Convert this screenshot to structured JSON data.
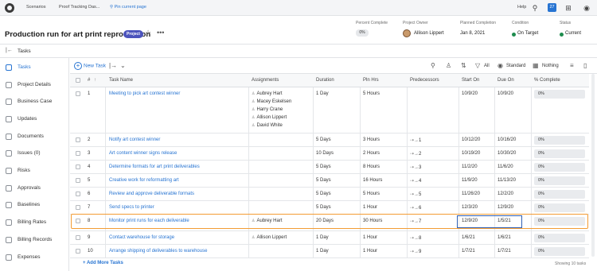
{
  "topbar": {
    "tabs": [
      "Scenarios",
      "Proof Tracking Das..."
    ],
    "pin_label": "Pin current page",
    "help": "Help",
    "badge_count": "27"
  },
  "header": {
    "title": "Production run for art print reproduction",
    "badge": "Project",
    "percent_label": "Percent Complete",
    "percent_value": "0%",
    "owner_label": "Project Owner",
    "owner_value": "Allison Lippert",
    "planned_label": "Planned Completion",
    "planned_value": "Jan 8, 2021",
    "condition_label": "Condition",
    "condition_value": "On Target",
    "status_label": "Status",
    "status_value": "Current",
    "accent_color": "#1e8c4e"
  },
  "subbar": {
    "label": "Tasks"
  },
  "sidebar": {
    "items": [
      {
        "label": "Tasks",
        "icon": "tasks-icon"
      },
      {
        "label": "Project Details",
        "icon": "details-icon"
      },
      {
        "label": "Business Case",
        "icon": "briefcase-icon"
      },
      {
        "label": "Updates",
        "icon": "updates-icon"
      },
      {
        "label": "Documents",
        "icon": "documents-icon"
      },
      {
        "label": "Issues (0)",
        "icon": "issues-icon"
      },
      {
        "label": "Risks",
        "icon": "risks-icon"
      },
      {
        "label": "Approvals",
        "icon": "approvals-icon"
      },
      {
        "label": "Baselines",
        "icon": "baselines-icon"
      },
      {
        "label": "Billing Rates",
        "icon": "billing-rates-icon"
      },
      {
        "label": "Billing Records",
        "icon": "billing-records-icon"
      },
      {
        "label": "Expenses",
        "icon": "expenses-icon"
      }
    ]
  },
  "toolbar": {
    "new_task": "New Task",
    "filter": "All",
    "view": "Standard",
    "grouping": "Nothing"
  },
  "grid": {
    "columns": [
      "#",
      "Task Name",
      "Assignments",
      "Duration",
      "Pln Hrs",
      "Predecessors",
      "Start On",
      "Due On",
      "% Complete"
    ],
    "rows": [
      {
        "num": "1",
        "name": "Meeting to pick art contest winner",
        "assign": [
          "Aubrey Hart",
          "Macey Eskelsen",
          "Harry Crane",
          "Allison Lippert",
          "David White"
        ],
        "duration": "1 Day",
        "hours": "5 Hours",
        "pred": "",
        "start": "10/9/20",
        "due": "10/9/20",
        "pct": "0%"
      },
      {
        "num": "2",
        "name": "Notify art contest winner",
        "assign": [],
        "duration": "5 Days",
        "hours": "3 Hours",
        "pred": "1",
        "start": "10/12/20",
        "due": "10/16/20",
        "pct": "0%"
      },
      {
        "num": "3",
        "name": "Art content winner signs release",
        "assign": [],
        "duration": "10 Days",
        "hours": "2 Hours",
        "pred": "2",
        "start": "10/19/20",
        "due": "10/30/20",
        "pct": "0%"
      },
      {
        "num": "4",
        "name": "Determine formats for art print deliverables",
        "assign": [],
        "duration": "5 Days",
        "hours": "8 Hours",
        "pred": "3",
        "start": "11/2/20",
        "due": "11/6/20",
        "pct": "0%"
      },
      {
        "num": "5",
        "name": "Creative work for reformatting art",
        "assign": [],
        "duration": "5 Days",
        "hours": "16 Hours",
        "pred": "4",
        "start": "11/9/20",
        "due": "11/13/20",
        "pct": "0%"
      },
      {
        "num": "6",
        "name": "Review and approve deliverable formats",
        "assign": [],
        "duration": "5 Days",
        "hours": "5 Hours",
        "pred": "5",
        "start": "11/26/20",
        "due": "12/2/20",
        "pct": "0%"
      },
      {
        "num": "7",
        "name": "Send specs to printer",
        "assign": [],
        "duration": "5 Days",
        "hours": "1 Hour",
        "pred": "6",
        "start": "12/3/20",
        "due": "12/9/20",
        "pct": "0%"
      },
      {
        "num": "8",
        "name": "Monitor print runs for each deliverable",
        "assign": [
          "Aubrey Hart"
        ],
        "duration": "20 Days",
        "hours": "30 Hours",
        "pred": "7",
        "start": "12/9/20",
        "due": "1/5/21",
        "pct": "0%"
      },
      {
        "num": "9",
        "name": "Contact warehouse for storage",
        "assign": [
          "Allison Lippert"
        ],
        "duration": "1 Day",
        "hours": "1 Hour",
        "pred": "8",
        "start": "1/6/21",
        "due": "1/6/21",
        "pct": "0%"
      },
      {
        "num": "10",
        "name": "Arrange shipping of deliverables to warehouse",
        "assign": [],
        "duration": "1 Day",
        "hours": "1 Hour",
        "pred": "9",
        "start": "1/7/21",
        "due": "1/7/21",
        "pct": "0%"
      }
    ],
    "add_more": "+ Add More Tasks",
    "showing": "Showing 10 tasks"
  }
}
